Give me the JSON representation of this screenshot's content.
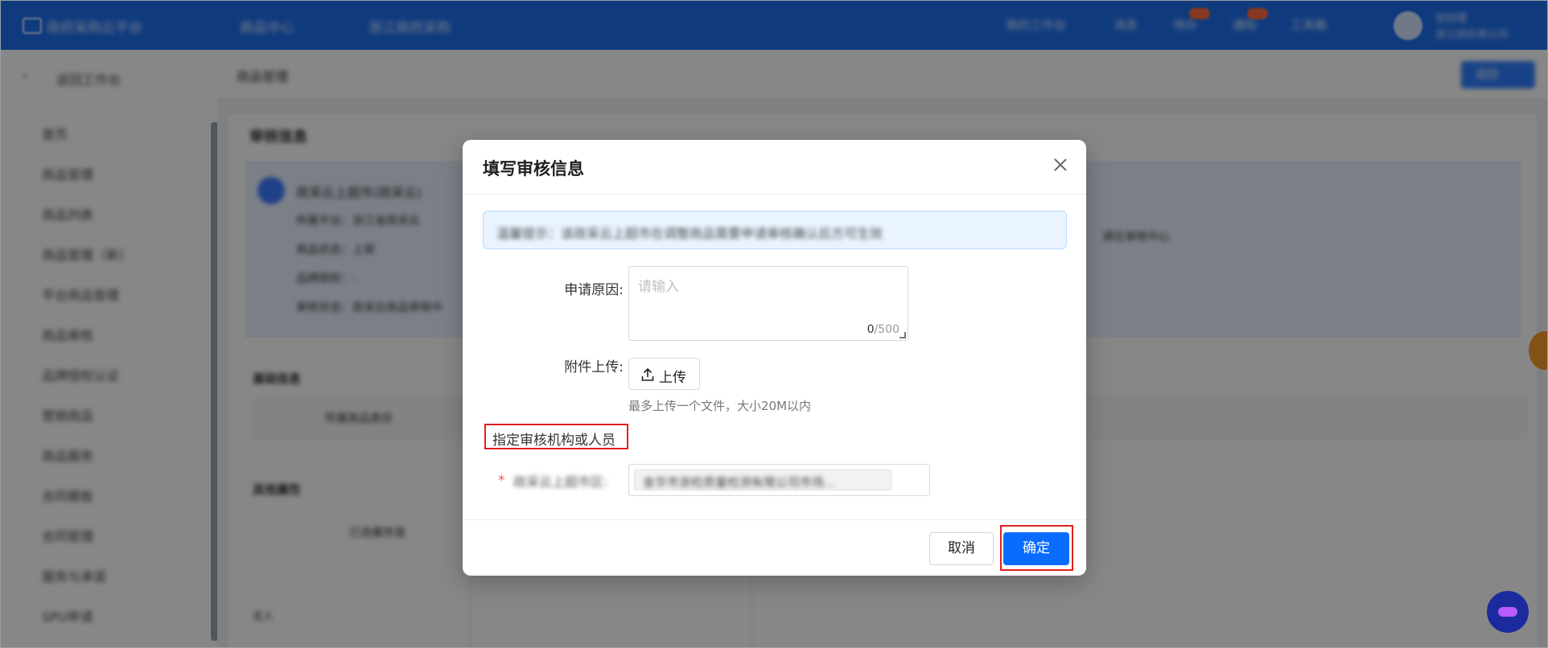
{
  "app": {
    "title": "政府采购云平台",
    "top_nav": [
      "商品中心",
      "浙江政府采购"
    ],
    "top_right": [
      "我的工作台",
      "消息",
      "待办",
      "通知",
      "工具箱"
    ],
    "user": {
      "name": "张经理",
      "org": "浙江供应商公司"
    }
  },
  "sidebar": {
    "back_label": "返回工作台",
    "items": [
      "首页",
      "商品管理",
      "商品列表",
      "商品管理（新）",
      "平台商品管理",
      "商品审核",
      "品牌授权认证",
      "营销商品",
      "商品服务",
      "合同模板",
      "合同管理",
      "服务与承诺",
      "SPU申请"
    ]
  },
  "main": {
    "breadcrumb": "商品管理",
    "action_button": "返回",
    "page_heading": "审核信息",
    "info_rows": [
      "政采云上超市(政采云)",
      "所属平台：浙江省政采云",
      "商品状态：上架",
      "品牌授权：-",
      "审核状态：政采云商品审核中"
    ],
    "right_note": "请在审核中心",
    "section1": "基础信息",
    "section2": "其他属性",
    "field_a": "所属商品类目",
    "field_b": "已选属性值",
    "tail": "无人"
  },
  "modal": {
    "title": "填写审核信息",
    "tip": "温馨提示：该政采云上超市在调整商品需要申请审核确认后方可生效",
    "reason_label": "申请原因:",
    "reason_placeholder": "请输入",
    "reason_count": "0",
    "reason_max": "/500",
    "upload_label": "附件上传:",
    "upload_button": "上传",
    "upload_hint": "最多上传一个文件，大小20M以内",
    "section_title": "指定审核机构或人员",
    "reviewer_label": "政采云上超市区:",
    "reviewer_value": "金华市浙检质量检测有限公司市场...",
    "cancel": "取消",
    "confirm": "确定"
  },
  "colors": {
    "primary": "#0a6cff",
    "topbar": "#1e6fef",
    "highlight_frame": "#e0201d",
    "required": "#ff4d4f"
  }
}
